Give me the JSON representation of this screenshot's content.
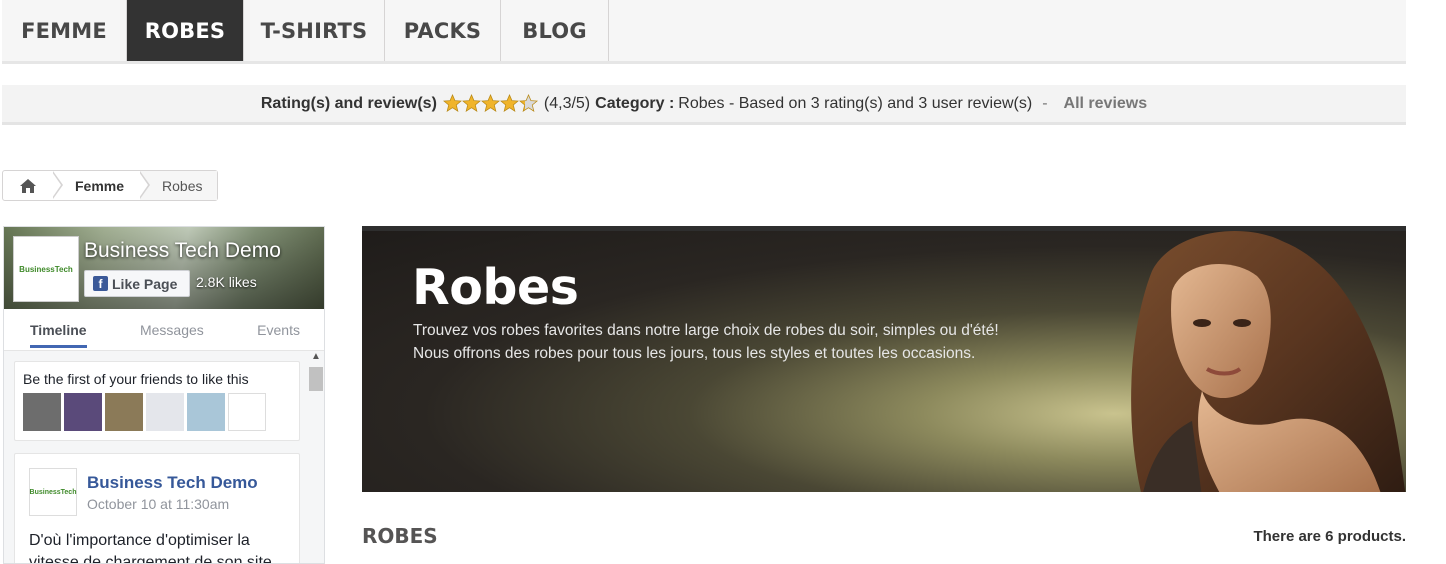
{
  "nav": {
    "items": [
      "FEMME",
      "ROBES",
      "T-SHIRTS",
      "PACKS",
      "BLOG"
    ],
    "active": "ROBES"
  },
  "rating": {
    "label": "Rating(s) and review(s)",
    "score": 4.3,
    "stars_max": 5,
    "score_text": "(4,3/5)",
    "category_label": "Category :",
    "category_text": "Robes - Based on 3 rating(s) and 3 user review(s)",
    "separator": "-",
    "all_reviews": "All reviews"
  },
  "breadcrumb": {
    "home_icon": "home-icon",
    "items": [
      "Femme",
      "Robes"
    ]
  },
  "facebook": {
    "page_name": "Business Tech Demo",
    "logo_text": "BusinessTech",
    "like_button": "Like Page",
    "likes": "2.8K likes",
    "tabs": [
      "Timeline",
      "Messages",
      "Events"
    ],
    "active_tab": "Timeline",
    "friends_text": "Be the first of your friends to like this",
    "friend_count": 6,
    "post": {
      "author": "Business Tech Demo",
      "date": "October 10 at 11:30am",
      "text": "D'où l'importance d'optimiser la vitesse de chargement de son site"
    }
  },
  "banner": {
    "title": "Robes",
    "line1": "Trouvez vos robes favorites dans notre large choix de robes du soir, simples ou d'été!",
    "line2": "Nous offrons des robes pour tous les jours, tous les styles et toutes les occasions."
  },
  "category": {
    "title": "ROBES",
    "product_count": "There are 6 products."
  },
  "colors": {
    "nav_active_bg": "#333333",
    "star": "#f0b42a",
    "fb_blue": "#4267b2",
    "link": "#365899"
  }
}
